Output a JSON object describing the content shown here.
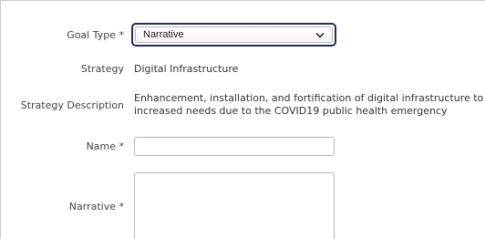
{
  "form": {
    "goal_type": {
      "label": "Goal Type *",
      "selected": "Narrative"
    },
    "strategy": {
      "label": "Strategy",
      "value": "Digital Infrastructure"
    },
    "strategy_description": {
      "label": "Strategy Description",
      "line1": "Enhancement, installation, and fortification of digital infrastructure to respond",
      "line2": "increased needs due to the COVID19 public health emergency"
    },
    "name": {
      "label": "Name *",
      "value": ""
    },
    "narrative": {
      "label": "Narrative *",
      "value": ""
    }
  },
  "icons": {
    "select_chevron": "chevron-down-icon"
  },
  "colors": {
    "focus_ring": "#232b6b",
    "border": "#b5b5b5"
  }
}
